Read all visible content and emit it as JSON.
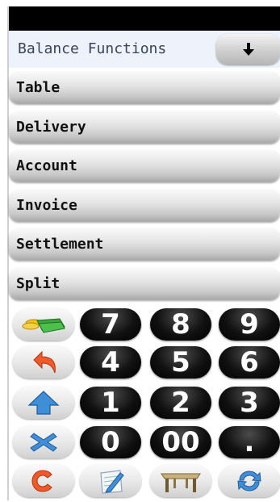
{
  "header": {
    "title": "Balance Functions",
    "dropdown_icon": "arrow-down-icon"
  },
  "menu": [
    {
      "label": "Table"
    },
    {
      "label": "Delivery"
    },
    {
      "label": "Account"
    },
    {
      "label": "Invoice"
    },
    {
      "label": "Settlement"
    },
    {
      "label": "Split"
    }
  ],
  "keypad": {
    "digits": [
      "7",
      "8",
      "9",
      "4",
      "5",
      "6",
      "1",
      "2",
      "3",
      "0",
      "00",
      "."
    ],
    "function_icons": [
      "cash-icon",
      "undo-icon",
      "shift-up-icon",
      "cancel-icon",
      "clear-icon",
      "edit-icon",
      "table-icon",
      "refresh-icon"
    ]
  },
  "colors": {
    "header_bg": "#eef3fb",
    "key_black": "#000000",
    "accent_orange": "#e8571f",
    "accent_blue": "#3a86cf"
  }
}
